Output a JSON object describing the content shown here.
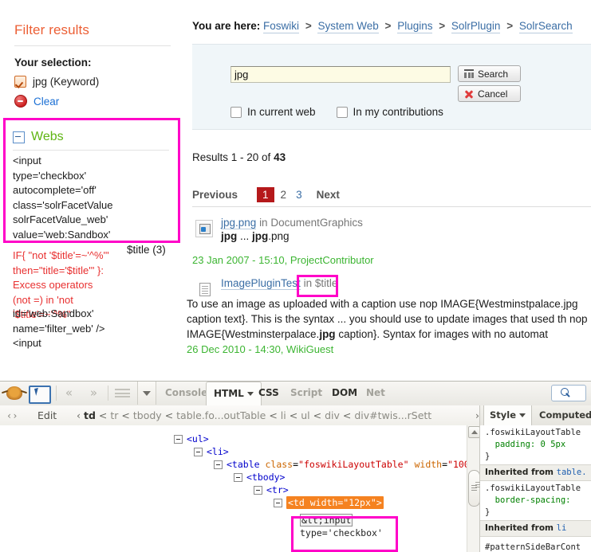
{
  "sidebar": {
    "title": "Filter results",
    "selection_label": "Your selection:",
    "selected_facet": "jpg (Keyword)",
    "clear_label": "Clear",
    "facet_group_label": "Webs",
    "facet_raw_html": "<input\ntype='checkbox'\nautocomplete='off'\nclass='solrFacetValue\nsolrFacetValue_web'\nvalue='web:Sandbox'",
    "overflow_error": "IF{ \"not '$title'=~'^%'\"\nthen=\"title='$title'\" }:\nExcess operators\n(not =) in 'not\n'$title'=~'^%\"",
    "overflow_attrs": "id='web:Sandbox'\nname='filter_web' />\n<input",
    "title_count": "$title (3)"
  },
  "breadcrumb": {
    "prefix": "You are here:",
    "items": [
      "Foswiki",
      "System Web",
      "Plugins",
      "SolrPlugin",
      "SolrSearch"
    ],
    "separator": ">"
  },
  "search": {
    "query_value": "jpg",
    "placeholder": "",
    "search_button": "Search",
    "cancel_button": "Cancel",
    "checkbox_current_web": "In current web",
    "checkbox_my_contributions": "In my contributions"
  },
  "results": {
    "count_prefix": "Results 1 - 20 of",
    "count_total": "43",
    "pager": {
      "previous": "Previous",
      "next": "Next",
      "pages": [
        "1",
        "2",
        "3"
      ],
      "current": "1"
    },
    "items": [
      {
        "icon": "image-file-icon",
        "link": "jpg.png",
        "in_label": "in",
        "location": "DocumentGraphics",
        "snippet": "jpg ... jpg.png",
        "meta": "23 Jan 2007 - 15:10, ProjectContributor"
      },
      {
        "icon": "document-file-icon",
        "link": "ImagePluginTest",
        "in_label": "in",
        "location": "$title",
        "snippet": "To use an image as uploaded with a caption use nop IMAGE{Westminstpalace.jpg caption text}. This is the syntax ... you should use to update images that used th nop IMAGE{Westminsterpalace.jpg caption}. Syntax for images with no automat",
        "meta": "26 Dec 2010 - 14:30, WikiGuest"
      }
    ]
  },
  "devtools": {
    "toolbar": {
      "bug_icon": "firebug-bug-icon",
      "inspect_icon": "inspect-element-icon",
      "back_icon": "chevron-left-icon",
      "forward_icon": "chevron-right-icon",
      "menu_icon": "hamburger-menu-icon",
      "dropdown_icon": "chevron-down-icon",
      "search_icon": "search-icon",
      "tabs": [
        "Console",
        "HTML",
        "CSS",
        "Script",
        "DOM",
        "Net"
      ],
      "active_tab": "HTML",
      "bold_tabs": [
        "HTML",
        "CSS",
        "DOM"
      ]
    },
    "crumbbar": {
      "code_icon": "code-brackets-icon",
      "edit_label": "Edit",
      "prev_arrow": "‹",
      "crumbs": [
        "td",
        "tr",
        "tbody",
        "table.fo...outTable",
        "li",
        "ul",
        "div",
        "div#twis...rSett"
      ],
      "separator": "<",
      "more_arrow": "›"
    },
    "html_tree": [
      {
        "indent": 0,
        "twisty": true,
        "markup_type": "tag",
        "text": "<ul>"
      },
      {
        "indent": 1,
        "twisty": true,
        "markup_type": "tag",
        "text": "<li>"
      },
      {
        "indent": 2,
        "twisty": true,
        "markup_type": "tag-attr",
        "tag": "<table",
        "attr": "class",
        "value": "\"foswikiLayoutTable\"",
        "attr2": "width",
        "value2": "\"100"
      },
      {
        "indent": 3,
        "twisty": true,
        "markup_type": "tag",
        "text": "<tbody>"
      },
      {
        "indent": 4,
        "twisty": true,
        "markup_type": "tag",
        "text": "<tr>"
      },
      {
        "indent": 5,
        "twisty": true,
        "markup_type": "selected",
        "tag": "<td",
        "attr": "width",
        "value": "\"12px\"",
        "close": ">"
      },
      {
        "indent": 6,
        "twisty": false,
        "markup_type": "text",
        "text": "&lt;input"
      },
      {
        "indent": 6,
        "twisty": false,
        "markup_type": "text",
        "text": "type='checkbox'"
      }
    ],
    "style_panel": {
      "tabs": [
        "Style",
        "Computed"
      ],
      "active_tab": "Style",
      "rules": [
        {
          "kind": "rule",
          "selector": ".foswikiLayoutTable",
          "declaration": "padding: 0 5px"
        },
        {
          "kind": "inherited",
          "label": "Inherited from",
          "target": "table."
        },
        {
          "kind": "rule",
          "selector": ".foswikiLayoutTable",
          "declaration": "border-spacing:"
        },
        {
          "kind": "inherited",
          "label": "Inherited from",
          "target": "li"
        },
        {
          "kind": "rule",
          "selector": "#patternSideBarCont",
          "declaration": ""
        }
      ]
    },
    "scrollbar": {
      "up_arrow_icon": "scroll-up-arrow-icon",
      "thumb_icon": "scrollbar-thumb"
    }
  },
  "annotations": {
    "highlight_color": "#ff00c8",
    "boxes": [
      "webs-facet-box",
      "title-placeholder-box",
      "html-text-node-box"
    ]
  }
}
